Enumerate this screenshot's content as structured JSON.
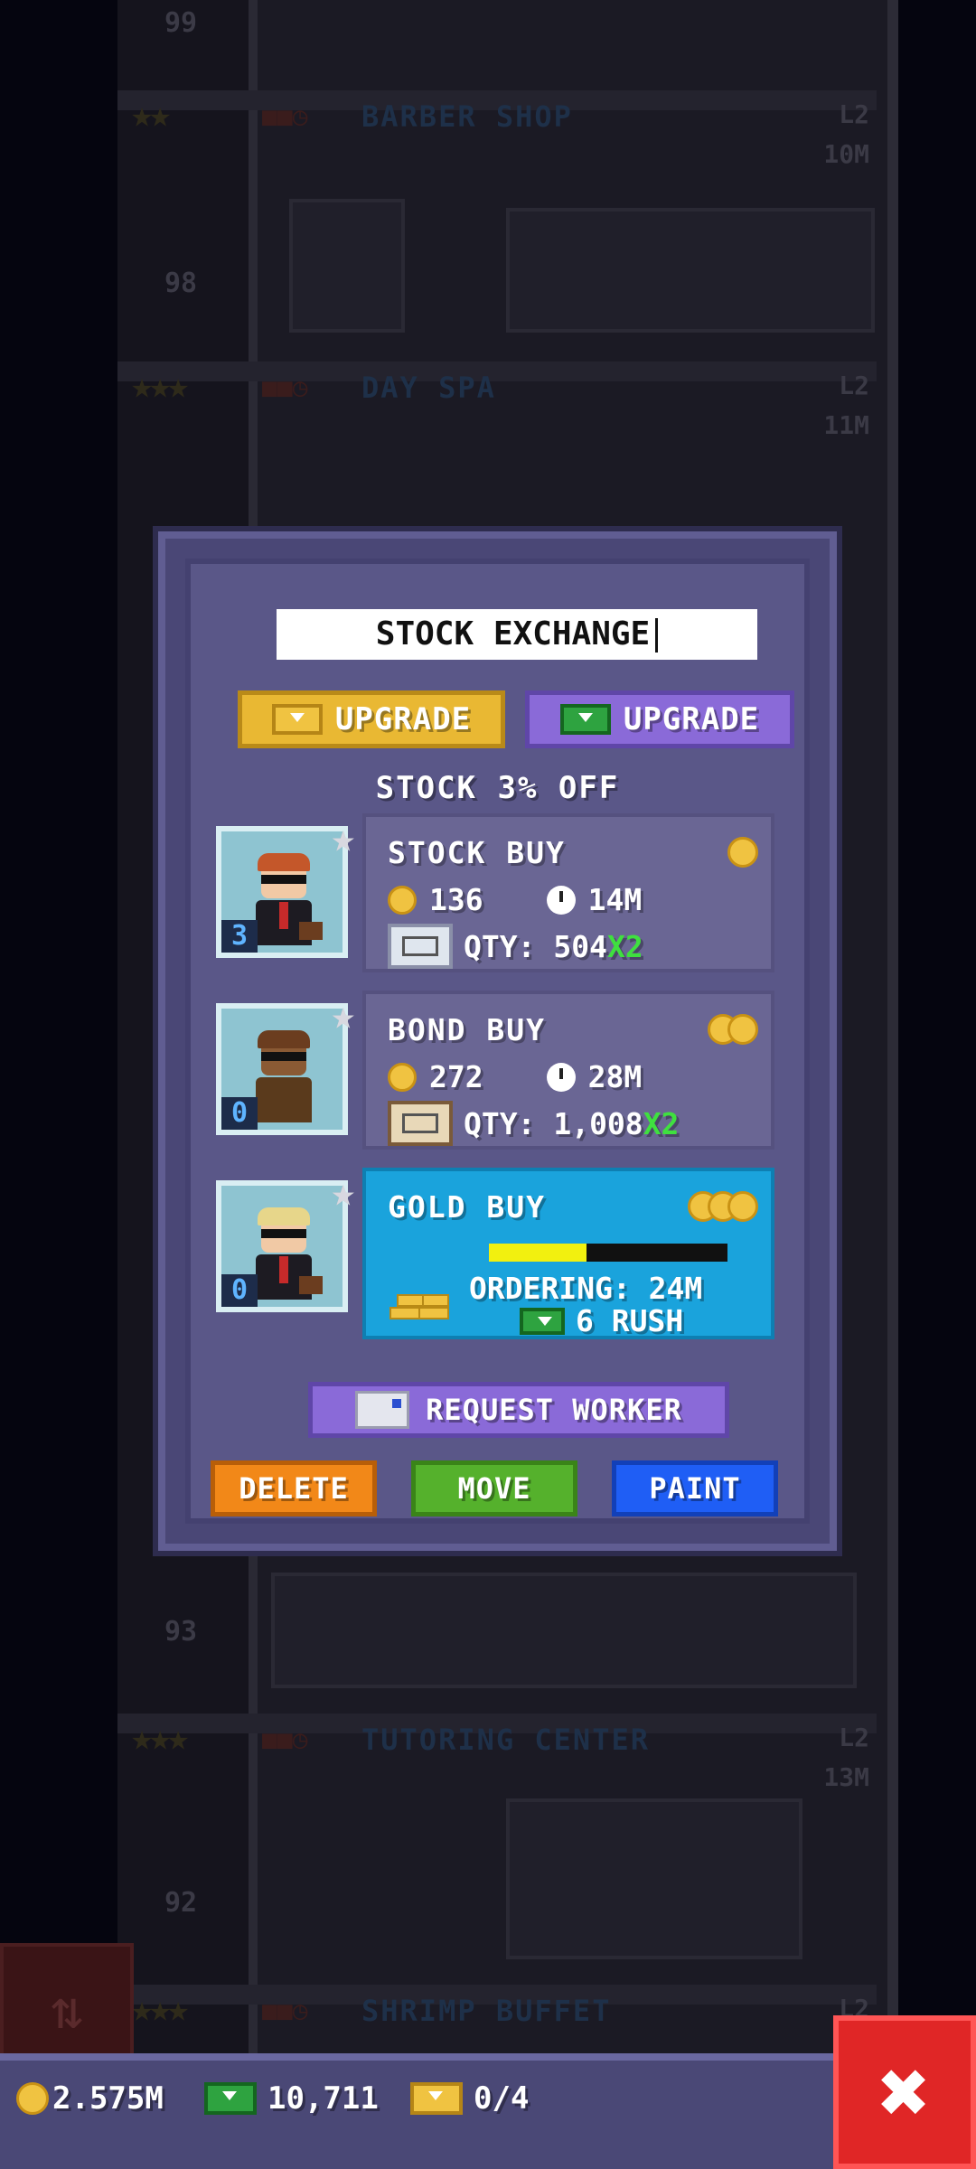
{
  "background": {
    "floors": [
      {
        "number": "99",
        "name": "",
        "level": "",
        "time": ""
      },
      {
        "number": "",
        "name": "BARBER SHOP",
        "level": "L2",
        "time": "10M"
      },
      {
        "number": "98",
        "name": "",
        "level": "",
        "time": ""
      },
      {
        "number": "",
        "name": "DAY SPA",
        "level": "L2",
        "time": "11M"
      },
      {
        "number": "93",
        "name": "",
        "level": "",
        "time": ""
      },
      {
        "number": "",
        "name": "TUTORING CENTER",
        "level": "L2",
        "time": "13M"
      },
      {
        "number": "92",
        "name": "",
        "level": "",
        "time": ""
      },
      {
        "number": "",
        "name": "SHRIMP BUFFET",
        "level": "L2",
        "time": ""
      }
    ],
    "elevator_button": "⇅"
  },
  "dialog": {
    "name_value": "STOCK EXCHANGE",
    "upgrade_coin_label": "UPGRADE",
    "upgrade_bux_label": "UPGRADE",
    "discount_text": "STOCK 3% OFF",
    "workers": [
      {
        "count": "3",
        "skin": "#f1c9a5",
        "hair": "#c4572a",
        "star": "★"
      },
      {
        "count": "0",
        "skin": "#8a5a34",
        "hair": "#6b3d1f",
        "star": "★"
      },
      {
        "count": "0",
        "skin": "#f1c9a5",
        "hair": "#e7d68a",
        "star": "★"
      }
    ],
    "products": [
      {
        "title": "STOCK BUY",
        "cost": "136",
        "time": "14M",
        "qty": "QTY: 504",
        "mult": "X2",
        "tier": 1
      },
      {
        "title": "BOND BUY",
        "cost": "272",
        "time": "28M",
        "qty": "QTY: 1,008",
        "mult": "X2",
        "tier": 2
      }
    ],
    "gold": {
      "title": "GOLD BUY",
      "tier": 3,
      "progress": 0.41,
      "ordering": "ORDERING: 24M",
      "rush": "6 RUSH"
    },
    "request_worker_label": "REQUEST WORKER",
    "delete_label": "DELETE",
    "move_label": "MOVE",
    "paint_label": "PAINT"
  },
  "bottom_bar": {
    "coins": "2.575M",
    "bux": "10,711",
    "tickets": "0/4",
    "close_glyph": "✖"
  },
  "colors": {
    "coin": "#f0c341",
    "bux": "#2ea340",
    "gold_card": "#1aa3dc",
    "multiplier": "#3fe03f",
    "delete": "#f28818",
    "move": "#55b12c",
    "paint": "#1f5ef5",
    "close": "#e02626"
  }
}
